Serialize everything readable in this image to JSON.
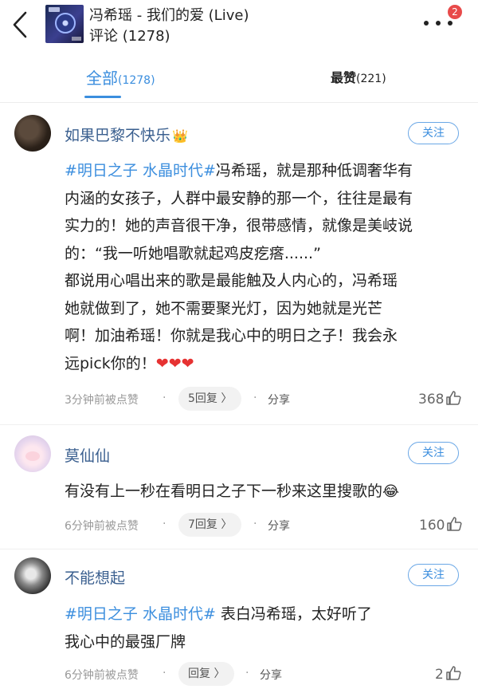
{
  "header": {
    "title": "冯希瑶 - 我们的爱 (Live)",
    "subtitle": "评论 (1278)",
    "notification_count": "2",
    "icons": {
      "back": "back-arrow-icon",
      "more": "more-dots-icon",
      "thumb": "album-cover-thumbnail"
    }
  },
  "tabs": [
    {
      "label": "全部",
      "count": "(1278)",
      "active": true
    },
    {
      "label": "最赞",
      "count": "(221)",
      "active": false
    }
  ],
  "colors": {
    "accent": "#3b8ede",
    "badge": "#e84a4a",
    "heart": "#e63232",
    "username": "#3a5f8f"
  },
  "comments": [
    {
      "username": "如果巴黎不快乐",
      "badge": "👑",
      "follow_label": "关注",
      "lines": [
        {
          "tag": "#明日之子 水晶时代#",
          "text": "冯希瑶，就是那种低调奢华有"
        },
        {
          "text": "内涵的女孩子，人群中最安静的那一个，往往是最有"
        },
        {
          "text": "实力的！她的声音很干净，很带感情，就像是美岐说"
        },
        {
          "text": "的：“我一听她唱歌就起鸡皮疙瘩......”"
        },
        {
          "text": "都说用心唱出来的歌是最能触及人内心的，冯希瑶"
        },
        {
          "text": "她就做到了，她不需要聚光灯，因为她就是光芒"
        },
        {
          "text": "啊！加油希瑶！你就是我心中的明日之子！我会永"
        },
        {
          "text": "远pick你的！",
          "hearts": "❤❤❤"
        }
      ],
      "time": "3分钟前被点赞",
      "reply_label": "5回复 〉",
      "share_label": "分享",
      "likes": "368"
    },
    {
      "username": "莫仙仙",
      "follow_label": "关注",
      "lines": [
        {
          "text": "有没有上一秒在看明日之子下一秒来这里搜歌的",
          "emoji": "😂"
        }
      ],
      "time": "6分钟前被点赞",
      "reply_label": "7回复 〉",
      "share_label": "分享",
      "likes": "160"
    },
    {
      "username": "不能想起",
      "follow_label": "关注",
      "lines": [
        {
          "tag": "#明日之子 水晶时代#",
          "text": " 表白冯希瑶，太好听了"
        },
        {
          "text": "我心中的最强厂牌"
        }
      ],
      "time": "6分钟前被点赞",
      "reply_label": "回复 〉",
      "share_label": "分享",
      "likes": "2"
    }
  ]
}
